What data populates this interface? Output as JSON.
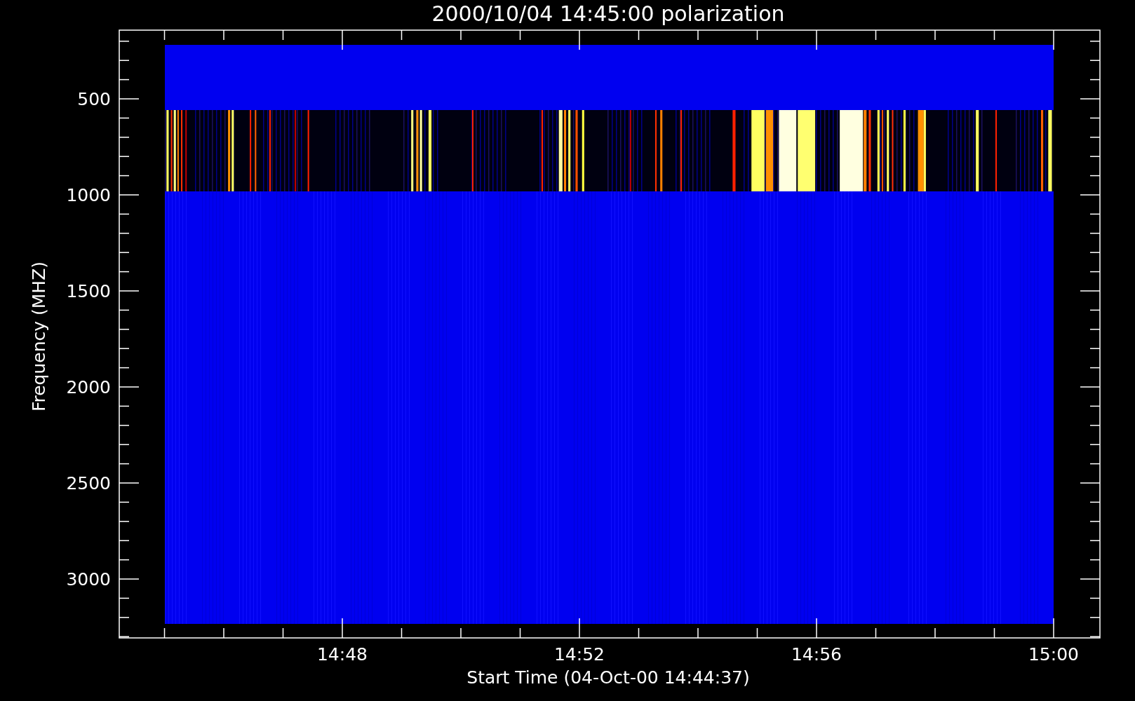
{
  "title": "2000/10/04 14:45:00 polarization",
  "ylabel": "Frequency (MHZ)",
  "xlabel": "Start Time (04-Oct-00 14:44:37)",
  "yticks": [
    "500",
    "1000",
    "1500",
    "2000",
    "2500",
    "3000"
  ],
  "xticks": [
    "14:48",
    "14:52",
    "14:56",
    "15:00"
  ]
}
